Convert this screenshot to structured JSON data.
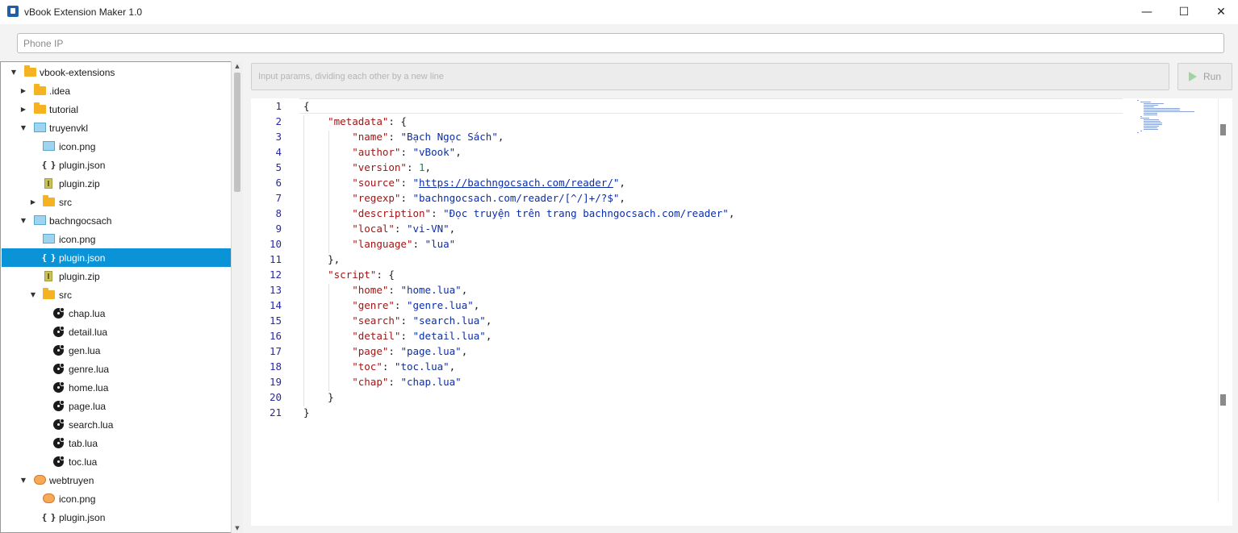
{
  "window": {
    "title": "vBook Extension Maker 1.0",
    "controls": {
      "minimize": "—",
      "maximize": "☐",
      "close": "✕"
    }
  },
  "phone_ip": {
    "placeholder": "Phone IP",
    "value": ""
  },
  "tree": {
    "rows": [
      {
        "label": "vbook-extensions",
        "depth": 0,
        "arrow": "▼",
        "icon": "folder-icon"
      },
      {
        "label": ".idea",
        "depth": 1,
        "arrow": "▶",
        "icon": "folder-icon"
      },
      {
        "label": "tutorial",
        "depth": 1,
        "arrow": "▶",
        "icon": "folder-icon"
      },
      {
        "label": "truyenvkl",
        "depth": 1,
        "arrow": "▼",
        "icon": "image-icon"
      },
      {
        "label": "icon.png",
        "depth": 2,
        "arrow": "",
        "icon": "image-icon"
      },
      {
        "label": "plugin.json",
        "depth": 2,
        "arrow": "",
        "icon": "json-icon"
      },
      {
        "label": "plugin.zip",
        "depth": 2,
        "arrow": "",
        "icon": "zip-icon"
      },
      {
        "label": "src",
        "depth": 2,
        "arrow": "▶",
        "icon": "folder-icon"
      },
      {
        "label": "bachngocsach",
        "depth": 1,
        "arrow": "▼",
        "icon": "image-icon"
      },
      {
        "label": "icon.png",
        "depth": 2,
        "arrow": "",
        "icon": "image-icon"
      },
      {
        "label": "plugin.json",
        "depth": 2,
        "arrow": "",
        "icon": "json-icon",
        "selected": true
      },
      {
        "label": "plugin.zip",
        "depth": 2,
        "arrow": "",
        "icon": "zip-icon"
      },
      {
        "label": "src",
        "depth": 2,
        "arrow": "▼",
        "icon": "folder-icon"
      },
      {
        "label": "chap.lua",
        "depth": 3,
        "arrow": "",
        "icon": "lua-icon"
      },
      {
        "label": "detail.lua",
        "depth": 3,
        "arrow": "",
        "icon": "lua-icon"
      },
      {
        "label": "gen.lua",
        "depth": 3,
        "arrow": "",
        "icon": "lua-icon"
      },
      {
        "label": "genre.lua",
        "depth": 3,
        "arrow": "",
        "icon": "lua-icon"
      },
      {
        "label": "home.lua",
        "depth": 3,
        "arrow": "",
        "icon": "lua-icon"
      },
      {
        "label": "page.lua",
        "depth": 3,
        "arrow": "",
        "icon": "lua-icon"
      },
      {
        "label": "search.lua",
        "depth": 3,
        "arrow": "",
        "icon": "lua-icon"
      },
      {
        "label": "tab.lua",
        "depth": 3,
        "arrow": "",
        "icon": "lua-icon"
      },
      {
        "label": "toc.lua",
        "depth": 3,
        "arrow": "",
        "icon": "lua-icon"
      },
      {
        "label": "webtruyen",
        "depth": 1,
        "arrow": "▼",
        "icon": "orange-image-icon"
      },
      {
        "label": "icon.png",
        "depth": 2,
        "arrow": "",
        "icon": "orange-image-icon"
      },
      {
        "label": "plugin.json",
        "depth": 2,
        "arrow": "",
        "icon": "json-icon"
      }
    ]
  },
  "params": {
    "placeholder": "Input params, dividing each other by a new line",
    "value": ""
  },
  "run_button": {
    "label": "Run"
  },
  "editor": {
    "lines": [
      [
        [
          "p",
          "{"
        ]
      ],
      [
        [
          "p",
          "    "
        ],
        [
          "k",
          "\"metadata\""
        ],
        [
          "p",
          ": {"
        ]
      ],
      [
        [
          "p",
          "        "
        ],
        [
          "k",
          "\"name\""
        ],
        [
          "p",
          ": "
        ],
        [
          "s",
          "\"Bạch Ngọc Sách\""
        ],
        [
          "p",
          ","
        ]
      ],
      [
        [
          "p",
          "        "
        ],
        [
          "k",
          "\"author\""
        ],
        [
          "p",
          ": "
        ],
        [
          "s",
          "\"vBook\""
        ],
        [
          "p",
          ","
        ]
      ],
      [
        [
          "p",
          "        "
        ],
        [
          "k",
          "\"version\""
        ],
        [
          "p",
          ": "
        ],
        [
          "n",
          "1"
        ],
        [
          "p",
          ","
        ]
      ],
      [
        [
          "p",
          "        "
        ],
        [
          "k",
          "\"source\""
        ],
        [
          "p",
          ": "
        ],
        [
          "s",
          "\""
        ],
        [
          "su",
          "https://bachngocsach.com/reader/"
        ],
        [
          "s",
          "\""
        ],
        [
          "p",
          ","
        ]
      ],
      [
        [
          "p",
          "        "
        ],
        [
          "k",
          "\"regexp\""
        ],
        [
          "p",
          ": "
        ],
        [
          "s",
          "\"bachngocsach.com/reader/[^/]+/?$\""
        ],
        [
          "p",
          ","
        ]
      ],
      [
        [
          "p",
          "        "
        ],
        [
          "k",
          "\"description\""
        ],
        [
          "p",
          ": "
        ],
        [
          "s",
          "\"Đọc truyện trên trang bachngocsach.com/reader\""
        ],
        [
          "p",
          ","
        ]
      ],
      [
        [
          "p",
          "        "
        ],
        [
          "k",
          "\"local\""
        ],
        [
          "p",
          ": "
        ],
        [
          "s",
          "\"vi-VN\""
        ],
        [
          "p",
          ","
        ]
      ],
      [
        [
          "p",
          "        "
        ],
        [
          "k",
          "\"language\""
        ],
        [
          "p",
          ": "
        ],
        [
          "s",
          "\"lua\""
        ]
      ],
      [
        [
          "p",
          "    },"
        ]
      ],
      [
        [
          "p",
          "    "
        ],
        [
          "k",
          "\"script\""
        ],
        [
          "p",
          ": {"
        ]
      ],
      [
        [
          "p",
          "        "
        ],
        [
          "k",
          "\"home\""
        ],
        [
          "p",
          ": "
        ],
        [
          "s",
          "\"home.lua\""
        ],
        [
          "p",
          ","
        ]
      ],
      [
        [
          "p",
          "        "
        ],
        [
          "k",
          "\"genre\""
        ],
        [
          "p",
          ": "
        ],
        [
          "s",
          "\"genre.lua\""
        ],
        [
          "p",
          ","
        ]
      ],
      [
        [
          "p",
          "        "
        ],
        [
          "k",
          "\"search\""
        ],
        [
          "p",
          ": "
        ],
        [
          "s",
          "\"search.lua\""
        ],
        [
          "p",
          ","
        ]
      ],
      [
        [
          "p",
          "        "
        ],
        [
          "k",
          "\"detail\""
        ],
        [
          "p",
          ": "
        ],
        [
          "s",
          "\"detail.lua\""
        ],
        [
          "p",
          ","
        ]
      ],
      [
        [
          "p",
          "        "
        ],
        [
          "k",
          "\"page\""
        ],
        [
          "p",
          ": "
        ],
        [
          "s",
          "\"page.lua\""
        ],
        [
          "p",
          ","
        ]
      ],
      [
        [
          "p",
          "        "
        ],
        [
          "k",
          "\"toc\""
        ],
        [
          "p",
          ": "
        ],
        [
          "s",
          "\"toc.lua\""
        ],
        [
          "p",
          ","
        ]
      ],
      [
        [
          "p",
          "        "
        ],
        [
          "k",
          "\"chap\""
        ],
        [
          "p",
          ": "
        ],
        [
          "s",
          "\"chap.lua\""
        ]
      ],
      [
        [
          "p",
          "    }"
        ]
      ],
      [
        [
          "p",
          "}"
        ]
      ]
    ]
  }
}
